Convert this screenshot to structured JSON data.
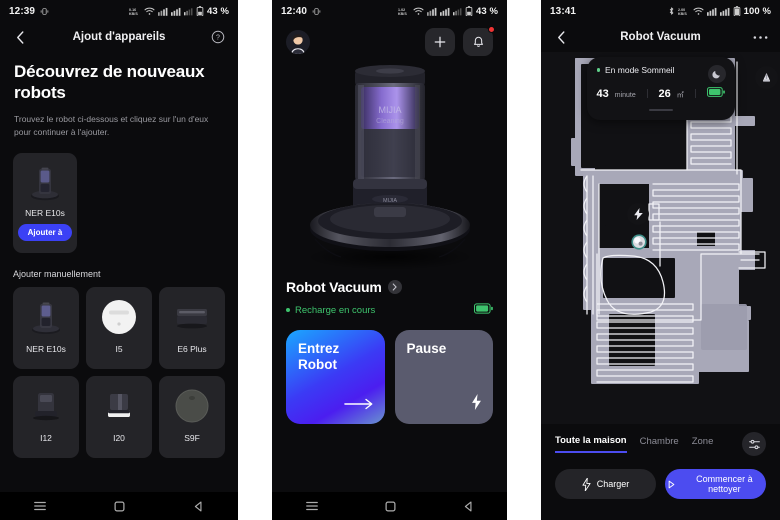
{
  "phone1": {
    "statusbar": {
      "time": "12:39",
      "battery": "43 %",
      "icons": [
        "vibrate-icon",
        "data-speed-icon",
        "wifi-icon",
        "signal-icon",
        "signal-icon",
        "signal-icon",
        "battery-icon"
      ]
    },
    "appbar": {
      "back_icon": "chevron-left-icon",
      "title": "Ajout d'appareils",
      "help_icon": "help-circle-icon"
    },
    "heading": "Découvrez de nouveaux robots",
    "subtitle": "Trouvez le robot ci-dessous et cliquez sur l'un d'eux pour continuer à l'ajouter.",
    "featured": {
      "name": "NER E10s",
      "button": "Ajouter à"
    },
    "manual_label": "Ajouter manuellement",
    "devices": [
      {
        "name": "NER E10s",
        "art": "dock-tower"
      },
      {
        "name": "I5",
        "art": "round-white"
      },
      {
        "name": "E6 Plus",
        "art": "flat-dock"
      },
      {
        "name": "I12",
        "art": "upright-dark"
      },
      {
        "name": "I20",
        "art": "square-dock"
      },
      {
        "name": "S9F",
        "art": "round-dark"
      }
    ],
    "navbar": {
      "menu": "menu-icon",
      "home": "home-icon",
      "back": "back-triangle-icon"
    }
  },
  "phone2": {
    "statusbar": {
      "time": "12:40",
      "battery": "43 %"
    },
    "header": {
      "avatar": "user-avatar",
      "add": "plus-icon",
      "bell": "bell-icon",
      "bell_badge": true
    },
    "device": {
      "title": "Robot Vacuum",
      "chevron": "chevron-right-icon",
      "status": "Recharge en cours",
      "status_color": "#3ec46d",
      "battery_icon": "battery-full-icon"
    },
    "actions": [
      {
        "label": "Entrez Robot",
        "icon": "arrow-right-icon",
        "style": "primary"
      },
      {
        "label": "Pause",
        "icon": "bolt-icon",
        "style": "secondary"
      }
    ],
    "navbar": {
      "menu": "menu-icon",
      "home": "home-icon",
      "back": "back-triangle-icon"
    }
  },
  "phone3": {
    "statusbar": {
      "time": "13:41",
      "battery": "100 %",
      "bluetooth": "bluetooth-icon"
    },
    "appbar": {
      "back_icon": "chevron-left-icon",
      "title": "Robot Vacuum",
      "more_icon": "more-horizontal-icon"
    },
    "statuscard": {
      "mode": "En mode Sommeil",
      "mode_icon": "sleep-moon-icon",
      "duration_value": "43",
      "duration_unit": "minute",
      "area_value": "26",
      "area_unit": "㎡",
      "battery_icon": "battery-full-icon"
    },
    "map": {
      "dock_pin": "dock-station-icon",
      "charge_pin": "charge-marker-icon",
      "robot_pin": "robot-marker-icon"
    },
    "tabs": [
      {
        "label": "Toute la maison",
        "active": true
      },
      {
        "label": "Chambre",
        "active": false
      },
      {
        "label": "Zone",
        "active": false
      }
    ],
    "tabs_settings_icon": "sliders-icon",
    "buttons": [
      {
        "label": "Charger",
        "icon": "bolt-icon",
        "style": "dark"
      },
      {
        "label": "Commencer à nettoyer",
        "icon": "play-icon",
        "style": "blue"
      }
    ]
  },
  "colors": {
    "accent_blue": "#4c4cf0",
    "status_green": "#3ec46d",
    "badge_red": "#f03434",
    "card_bg": "#242428",
    "screen_bg": "#0b0b0d"
  }
}
